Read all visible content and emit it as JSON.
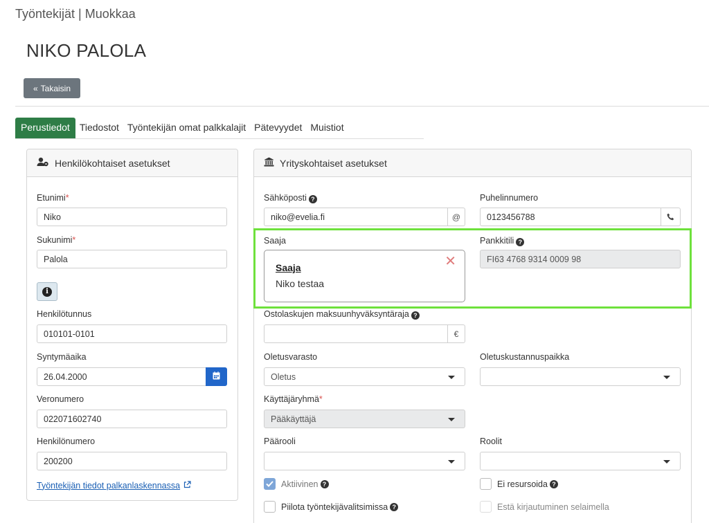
{
  "breadcrumb": "Työntekijät | Muokkaa",
  "title": "NIKO PALOLA",
  "back_label": "Takaisin",
  "tabs": [
    {
      "label": "Perustiedot",
      "active": true
    },
    {
      "label": "Tiedostot",
      "active": false
    },
    {
      "label": "Työntekijän omat palkkalajit",
      "active": false
    },
    {
      "label": "Pätevyydet",
      "active": false
    },
    {
      "label": "Muistiot",
      "active": false
    }
  ],
  "personal": {
    "heading": "Henkilökohtaiset asetukset",
    "first_name_label": "Etunimi",
    "first_name": "Niko",
    "last_name_label": "Sukunimi",
    "last_name": "Palola",
    "ssn_label": "Henkilötunnus",
    "ssn": "010101-0101",
    "birth_label": "Syntymäaika",
    "birth": "26.04.2000",
    "tax_label": "Veronumero",
    "tax": "022071602740",
    "person_no_label": "Henkilönumero",
    "person_no": "200200",
    "payroll_link": "Työntekijän tiedot palkanlaskennassa"
  },
  "company": {
    "heading": "Yrityskohtaiset asetukset",
    "email_label": "Sähköposti",
    "email": "niko@evelia.fi",
    "phone_label": "Puhelinnumero",
    "phone": "0123456788",
    "payee_label": "Saaja",
    "payee_card_title": "Saaja",
    "payee_card_name": "Niko testaa",
    "bank_label": "Pankkitili",
    "bank": "FI63 4768 9314 0009 98",
    "approval_label": "Ostolaskujen maksuunhyväksyntäraja",
    "approval": "",
    "currency_symbol": "€",
    "warehouse_label": "Oletusvarasto",
    "warehouse": "Oletus",
    "cost_center_label": "Oletuskustannuspaikka",
    "cost_center": "",
    "user_group_label": "Käyttäjäryhmä",
    "user_group": "Pääkäyttäjä",
    "main_role_label": "Päärooli",
    "main_role": "",
    "roles_label": "Roolit",
    "roles": "",
    "active_label": "Aktiivinen",
    "active": true,
    "no_resource_label": "Ei resursoida",
    "no_resource": false,
    "hide_label": "Piilota työntekijävalitsimissa",
    "hide": false,
    "block_login_label": "Estä kirjautuminen selaimella",
    "block_login": false
  },
  "colors": {
    "tab_active": "#2e7d46",
    "back_button": "#6c757d",
    "calendar_button": "#2166c9",
    "highlight": "#6ee13c",
    "required": "#d9534f",
    "link": "#1a5fb4"
  },
  "icons": [
    "angles-left-icon",
    "user-cog-icon",
    "bank-icon",
    "info-icon",
    "help-icon",
    "at-icon",
    "phone-icon",
    "calendar-icon",
    "close-icon",
    "external-link-icon",
    "check-icon",
    "chevron-down-icon"
  ]
}
